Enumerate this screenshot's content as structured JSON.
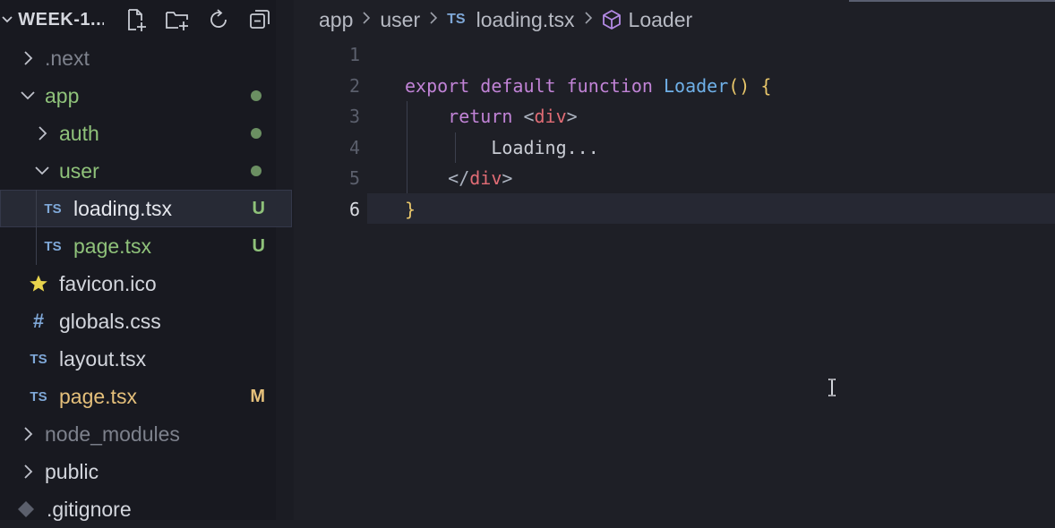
{
  "explorer": {
    "title": "WEEK-1...",
    "actions": [
      "new-file-icon",
      "new-folder-icon",
      "refresh-icon",
      "collapse-all-icon"
    ],
    "items": [
      {
        "name": ".next",
        "type": "folder",
        "expanded": false,
        "depth": 0,
        "color": "#7d818c"
      },
      {
        "name": "app",
        "type": "folder",
        "expanded": true,
        "depth": 0,
        "color": "#8fc27a",
        "status": "dot"
      },
      {
        "name": "auth",
        "type": "folder",
        "expanded": false,
        "depth": 1,
        "color": "#8fc27a",
        "status": "dot"
      },
      {
        "name": "user",
        "type": "folder",
        "expanded": true,
        "depth": 1,
        "color": "#8fc27a",
        "status": "dot"
      },
      {
        "name": "loading.tsx",
        "type": "ts",
        "depth": 2,
        "color": "#e6e8ee",
        "status": "U",
        "selected": true
      },
      {
        "name": "page.tsx",
        "type": "ts",
        "depth": 2,
        "color": "#8fc27a",
        "status": "U"
      },
      {
        "name": "favicon.ico",
        "type": "star",
        "depth": 1,
        "color": "#d3d6dd"
      },
      {
        "name": "globals.css",
        "type": "css",
        "depth": 1,
        "color": "#d3d6dd"
      },
      {
        "name": "layout.tsx",
        "type": "ts",
        "depth": 1,
        "color": "#d3d6dd"
      },
      {
        "name": "page.tsx",
        "type": "ts",
        "depth": 1,
        "color": "#e5c07b",
        "status": "M"
      },
      {
        "name": "node_modules",
        "type": "folder",
        "expanded": false,
        "depth": 0,
        "color": "#7d818c"
      },
      {
        "name": "public",
        "type": "folder",
        "expanded": false,
        "depth": 0,
        "color": "#d3d6dd"
      },
      {
        "name": ".gitignore",
        "type": "git",
        "depth": 0,
        "color": "#d3d6dd"
      }
    ]
  },
  "breadcrumb": {
    "parts": [
      "app",
      "user",
      "loading.tsx",
      "Loader"
    ],
    "file_icon": "TS",
    "symbol_icon": "cube-icon"
  },
  "editor": {
    "line_numbers": [
      "1",
      "2",
      "3",
      "4",
      "5",
      "6"
    ],
    "active_line": 6,
    "lines": [
      "",
      "export default function Loader() {",
      "    return <div>",
      "        Loading...",
      "    </div>",
      "}"
    ]
  },
  "colors": {
    "git_added": "#8fc27a",
    "git_modified": "#e5c07b",
    "ts_icon": "#7fa8d8",
    "keyword": "#c183d6",
    "function": "#6fb0e8",
    "bracket": "#e8c66a",
    "tag": "#e06c75"
  }
}
